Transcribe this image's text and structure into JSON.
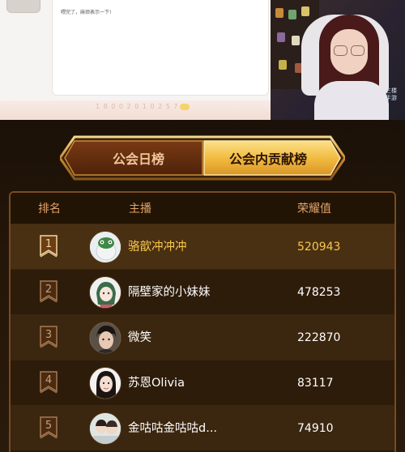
{
  "chat": {
    "message": "喂完了，麻烦表示一下!",
    "bottom_text": "1 8 0 0 2 0 1 0 2 5 7 0"
  },
  "webcam": {
    "logo_line1": "三楼",
    "logo_line2": "手游"
  },
  "tabs": [
    {
      "label": "公会日榜",
      "active": false
    },
    {
      "label": "公会内贡献榜",
      "active": true
    }
  ],
  "table": {
    "headers": {
      "rank": "排名",
      "host": "主播",
      "honor": "荣耀值"
    },
    "rows": [
      {
        "rank": "1",
        "name": "骆歆冲冲冲",
        "score": "520943",
        "avatar_icon": "green-frog-avatar-icon"
      },
      {
        "rank": "2",
        "name": "隔壁家的小妹妹",
        "score": "478253",
        "avatar_icon": "anime-girl-avatar-icon"
      },
      {
        "rank": "3",
        "name": "微笑",
        "score": "222870",
        "avatar_icon": "boy-portrait-avatar-icon"
      },
      {
        "rank": "4",
        "name": "苏恩Olivia",
        "score": "83117",
        "avatar_icon": "girl-portrait-avatar-icon"
      },
      {
        "rank": "5",
        "name": "金咕咕金咕咕d...",
        "score": "74910",
        "avatar_icon": "couple-photo-avatar-icon"
      }
    ]
  },
  "colors": {
    "gold": "#f6c64e",
    "header_text": "#e0a26a",
    "panel_bg": "#2a190b",
    "border": "#7a4a22"
  }
}
